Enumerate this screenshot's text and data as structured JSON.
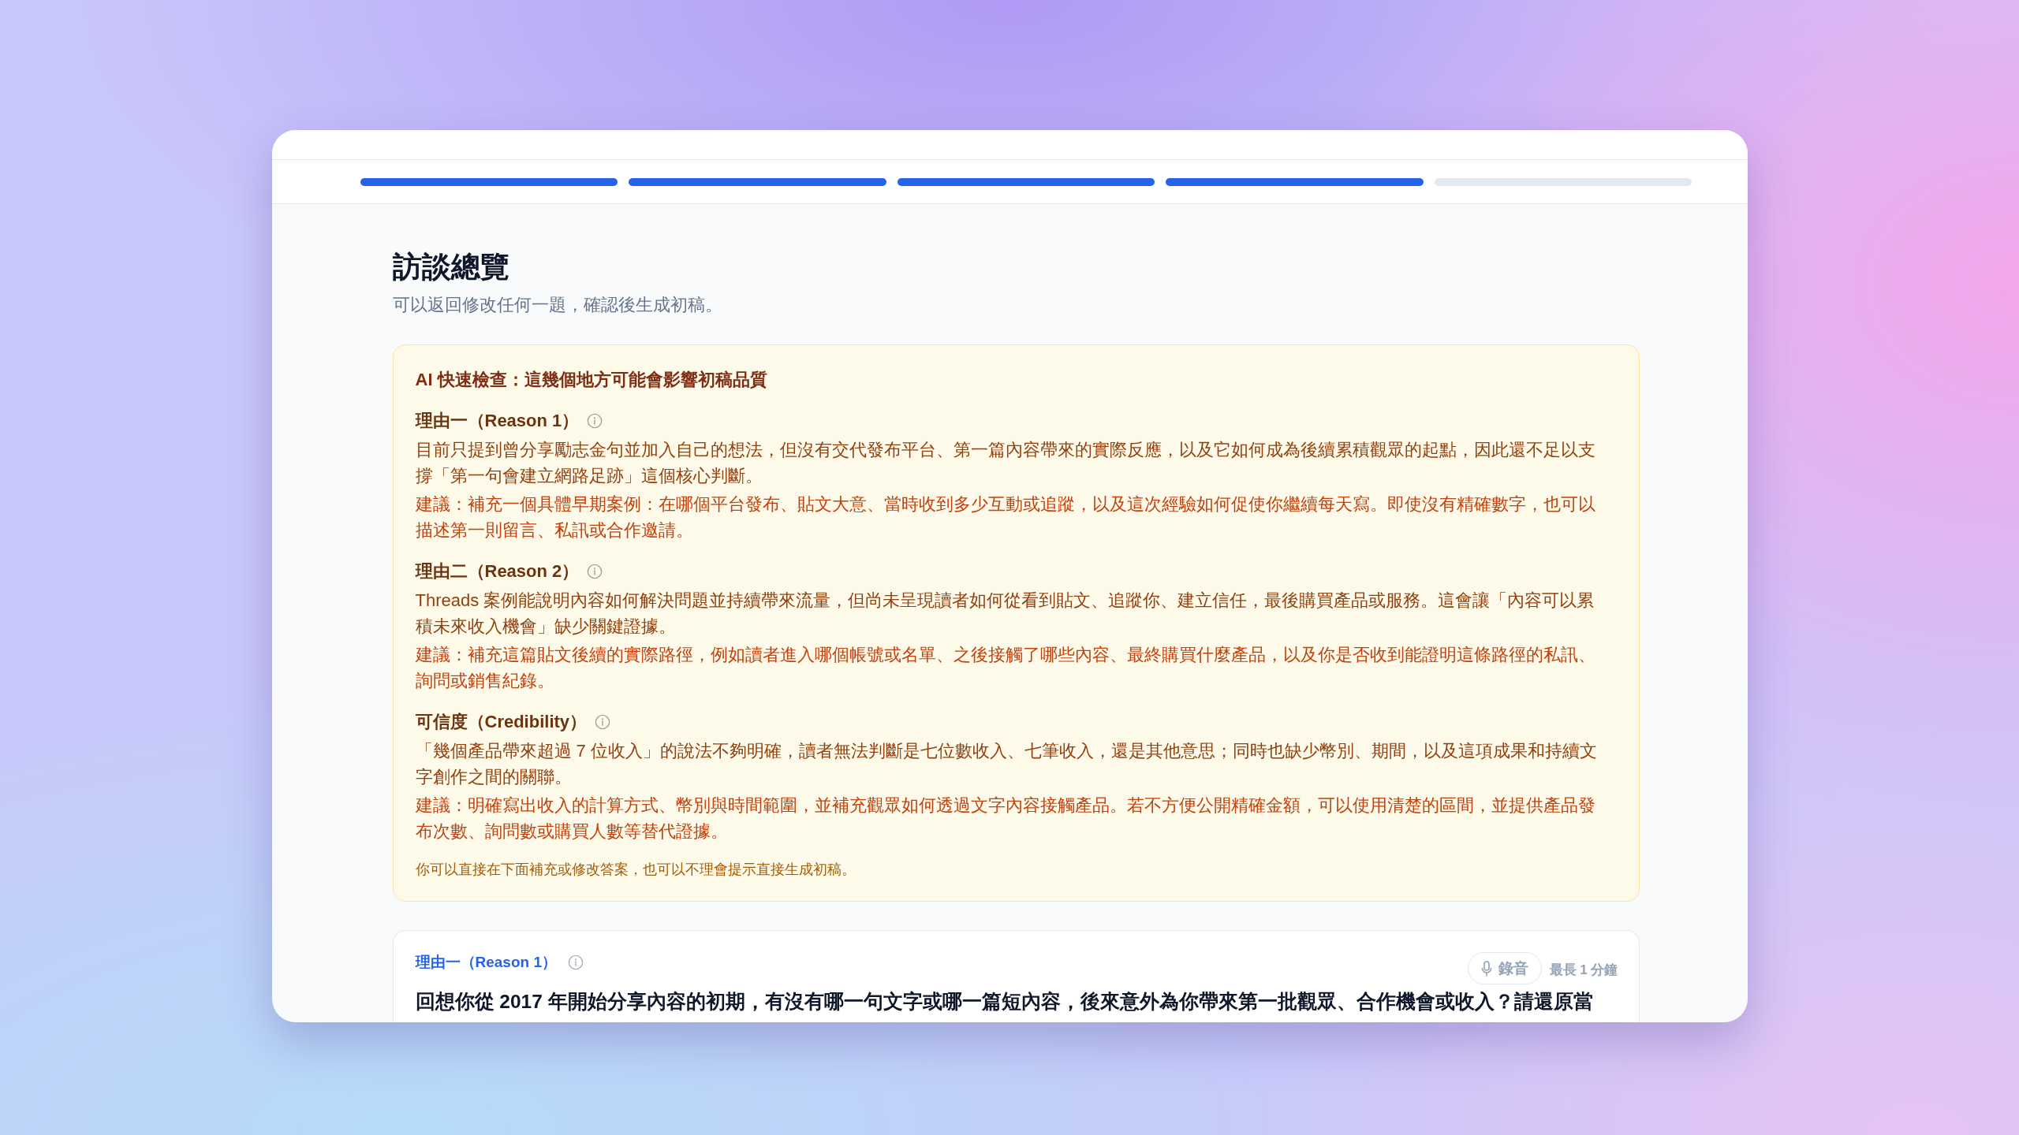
{
  "progress_steps": [
    {
      "complete": true
    },
    {
      "complete": true
    },
    {
      "complete": true
    },
    {
      "complete": true
    },
    {
      "complete": false
    }
  ],
  "page": {
    "title": "訪談總覽",
    "subtitle": "可以返回修改任何一題，確認後生成初稿。"
  },
  "ai_check": {
    "heading": "AI 快速檢查：這幾個地方可能會影響初稿品質",
    "items": [
      {
        "title": "理由一（Reason 1）",
        "issue": "目前只提到曾分享勵志金句並加入自己的想法，但沒有交代發布平台、第一篇內容帶來的實際反應，以及它如何成為後續累積觀眾的起點，因此還不足以支撐「第一句會建立網路足跡」這個核心判斷。",
        "suggestion": "建議：補充一個具體早期案例：在哪個平台發布、貼文大意、當時收到多少互動或追蹤，以及這次經驗如何促使你繼續每天寫。即使沒有精確數字，也可以描述第一則留言、私訊或合作邀請。"
      },
      {
        "title": "理由二（Reason 2）",
        "issue": "Threads 案例能說明內容如何解決問題並持續帶來流量，但尚未呈現讀者如何從看到貼文、追蹤你、建立信任，最後購買產品或服務。這會讓「內容可以累積未來收入機會」缺少關鍵證據。",
        "suggestion": "建議：補充這篇貼文後續的實際路徑，例如讀者進入哪個帳號或名單、之後接觸了哪些內容、最終購買什麼產品，以及你是否收到能證明這條路徑的私訊、詢問或銷售紀錄。"
      },
      {
        "title": "可信度（Credibility）",
        "issue": "「幾個產品帶來超過 7 位收入」的說法不夠明確，讀者無法判斷是七位數收入、七筆收入，還是其他意思；同時也缺少幣別、期間，以及這項成果和持續文字創作之間的關聯。",
        "suggestion": "建議：明確寫出收入的計算方式、幣別與時間範圍，並補充觀眾如何透過文字內容接觸產品。若不方便公開精確金額，可以使用清楚的區間，並提供產品發布次數、詢問數或購買人數等替代證據。"
      }
    ],
    "note": "你可以直接在下面補充或修改答案，也可以不理會提示直接生成初稿。"
  },
  "question_card": {
    "label": "理由一（Reason 1）",
    "record_button": "錄音",
    "limit": "最長 1 分鐘",
    "question": "回想你從 2017 年開始分享內容的初期，有沒有哪一句文字或哪一篇短內容，後來意外為你帶來第一批觀眾、合作機會或收入？請還原當"
  }
}
